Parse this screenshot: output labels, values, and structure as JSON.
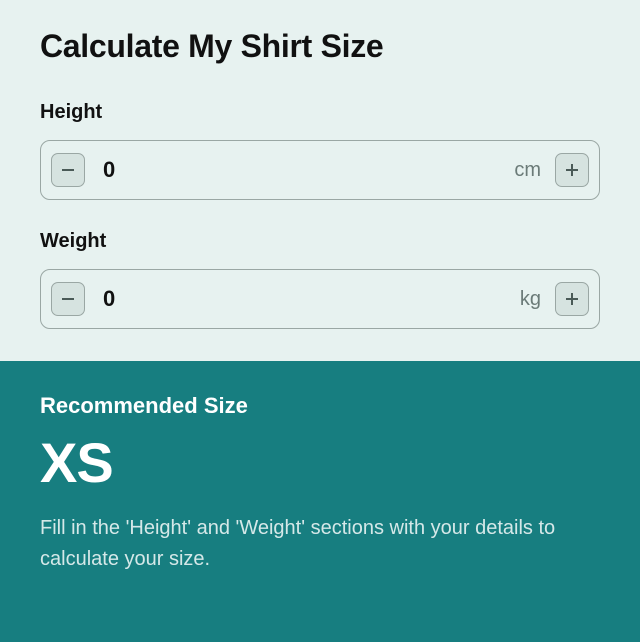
{
  "title": "Calculate My Shirt Size",
  "height": {
    "label": "Height",
    "value": "0",
    "unit": "cm"
  },
  "weight": {
    "label": "Weight",
    "value": "0",
    "unit": "kg"
  },
  "result": {
    "label": "Recommended Size",
    "size": "XS",
    "hint": "Fill in the 'Height' and 'Weight' sections with your details to calculate your size."
  }
}
